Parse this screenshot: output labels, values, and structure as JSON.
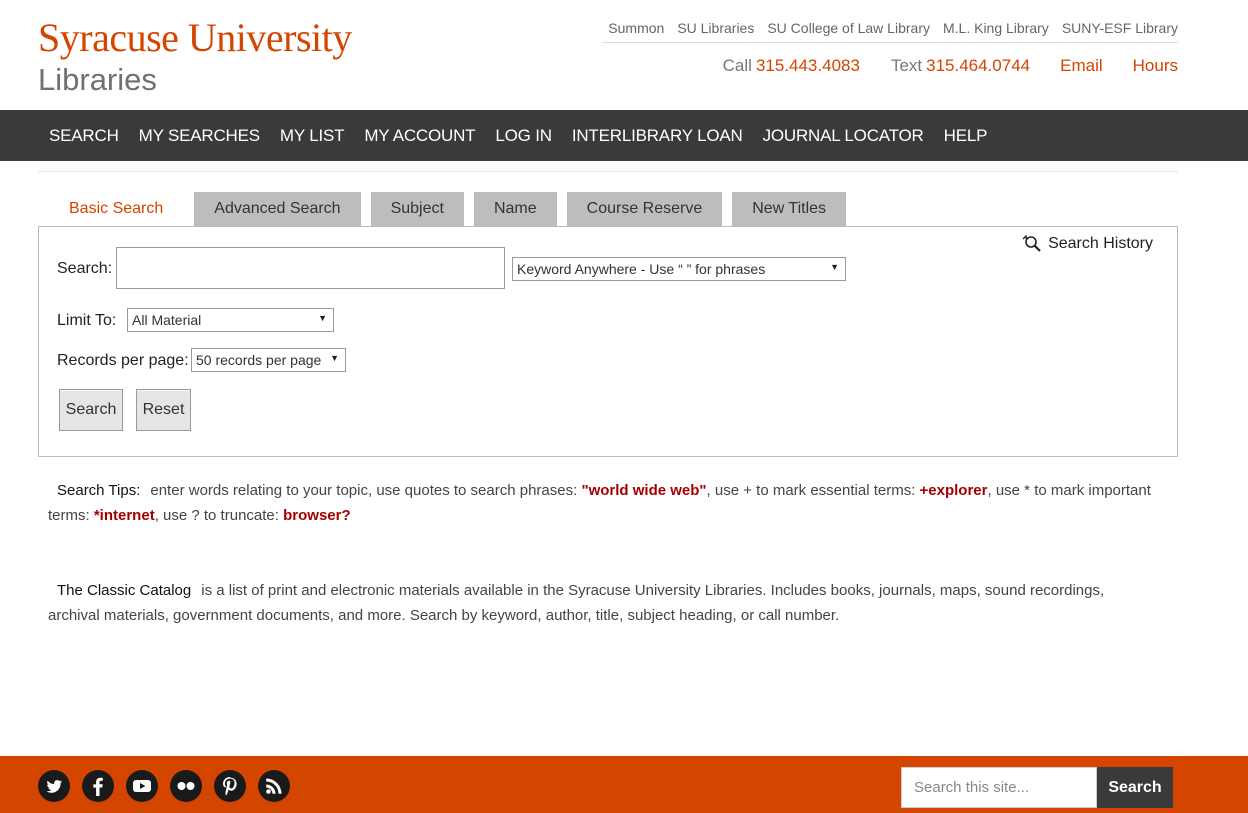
{
  "header": {
    "logo_line1": "Syracuse University",
    "logo_line2": "Libraries",
    "top_links": [
      "Summon",
      "SU Libraries",
      "SU College of Law Library",
      "M.L. King Library",
      "SUNY-ESF Library"
    ],
    "call_label": "Call",
    "call_number": "315.443.4083",
    "text_label": "Text",
    "text_number": "315.464.0744",
    "email": "Email",
    "hours": "Hours"
  },
  "nav": [
    "SEARCH",
    "MY SEARCHES",
    "MY LIST",
    "MY ACCOUNT",
    "LOG IN",
    "INTERLIBRARY LOAN",
    "JOURNAL LOCATOR",
    "HELP"
  ],
  "tabs": [
    "Basic Search",
    "Advanced Search",
    "Subject",
    "Name",
    "Course Reserve",
    "New Titles"
  ],
  "form": {
    "search_label": "Search:",
    "search_value": "",
    "search_type": "Keyword Anywhere - Use “ ” for phrases",
    "limit_label": "Limit To:",
    "limit_value": "All Material",
    "rpp_label": "Records per page:",
    "rpp_value": "50 records per page",
    "search_button": "Search",
    "reset_button": "Reset",
    "history_link": "Search History"
  },
  "tips": {
    "heading": "Search Tips:",
    "t1": "enter words relating to your topic, use quotes to search phrases: ",
    "e1": "\"world wide web\"",
    "t2": ", use + to mark essential terms: ",
    "e2": "+explorer",
    "t3": ", use * to mark important terms: ",
    "e3": "*internet",
    "t4": ", use ? to truncate: ",
    "e4": "browser?"
  },
  "classic": {
    "heading": "The Classic Catalog",
    "text": "is a list of print and electronic materials available in the Syracuse University Libraries. Includes books, journals, maps, sound recordings, archival materials, government documents, and more. Search by keyword, author, title, subject heading, or call number."
  },
  "footer": {
    "social": [
      "twitter-icon",
      "facebook-icon",
      "youtube-icon",
      "flickr-icon",
      "pinterest-icon",
      "rss-icon"
    ],
    "site_search_placeholder": "Search this site...",
    "site_search_button": "Search"
  },
  "colors": {
    "brand_orange": "#d44500",
    "nav_bg": "#3a3a3a",
    "tab_bg": "#bdbdbd",
    "highlight_red": "#a50000"
  }
}
